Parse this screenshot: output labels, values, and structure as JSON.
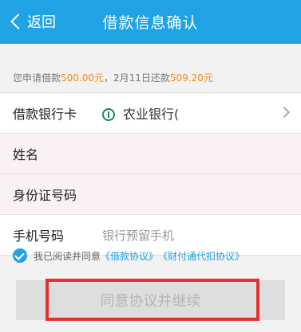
{
  "nav": {
    "back_label": "返回",
    "title": "借款信息确认"
  },
  "notice": {
    "prefix": "您申请借款",
    "loan_amount": "500.00元",
    "middle": "，2月11日还款",
    "repay_amount": "509.20元"
  },
  "form": {
    "bank_card": {
      "label": "借款银行卡",
      "value": "农业银行(",
      "icon": "abc-bank-icon"
    },
    "name": {
      "label": "姓名",
      "value": ""
    },
    "id_card": {
      "label": "身份证号码",
      "value": ""
    },
    "phone": {
      "label": "手机号码",
      "placeholder": "银行预留手机"
    }
  },
  "agreement": {
    "text": "我已阅读并同意",
    "link1": "《借款协议》",
    "link2": "《财付通代扣协议》"
  },
  "submit": {
    "label": "同意协议并继续"
  },
  "colors": {
    "nav_bg": "#1fa3e4",
    "accent_amount": "#f18b18",
    "highlight_border": "#e4302f"
  }
}
